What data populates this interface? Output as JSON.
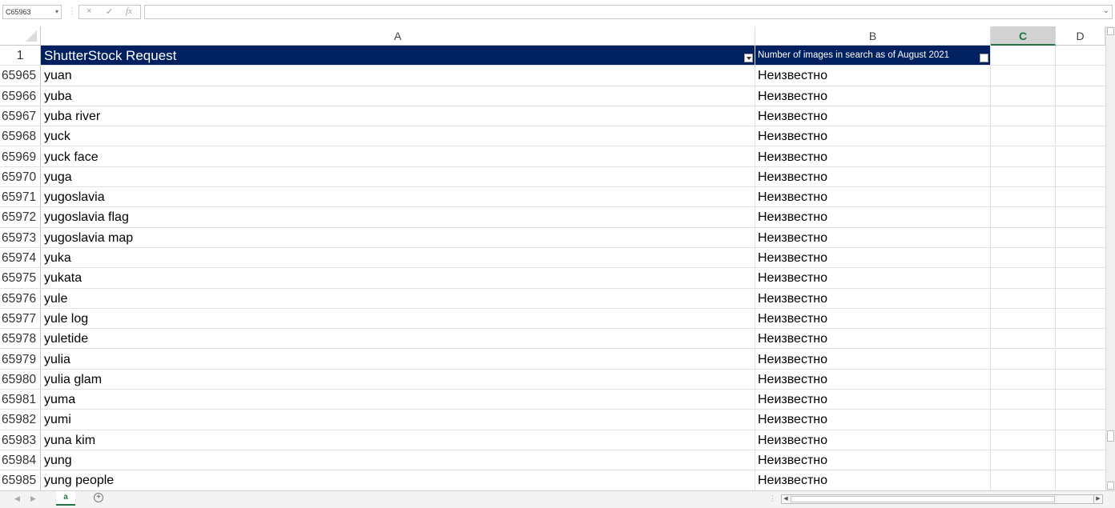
{
  "formula_bar": {
    "name_box": "C65963",
    "cancel_glyph": "×",
    "enter_glyph": "✓",
    "fx_label": "fx",
    "formula_value": ""
  },
  "columns": {
    "A": "A",
    "B": "B",
    "C": "C",
    "D": "D",
    "selected": "C"
  },
  "header_row": {
    "row_number": "1",
    "col_a": "ShutterStock Request",
    "col_b": "Number of images in search as of August 2021"
  },
  "rows": [
    {
      "n": "65965",
      "a": "yuan",
      "b": "Неизвестно"
    },
    {
      "n": "65966",
      "a": "yuba",
      "b": "Неизвестно"
    },
    {
      "n": "65967",
      "a": "yuba river",
      "b": "Неизвестно"
    },
    {
      "n": "65968",
      "a": "yuck",
      "b": "Неизвестно"
    },
    {
      "n": "65969",
      "a": "yuck face",
      "b": "Неизвестно"
    },
    {
      "n": "65970",
      "a": "yuga",
      "b": "Неизвестно"
    },
    {
      "n": "65971",
      "a": "yugoslavia",
      "b": "Неизвестно"
    },
    {
      "n": "65972",
      "a": "yugoslavia flag",
      "b": "Неизвестно"
    },
    {
      "n": "65973",
      "a": "yugoslavia map",
      "b": "Неизвестно"
    },
    {
      "n": "65974",
      "a": "yuka",
      "b": "Неизвестно"
    },
    {
      "n": "65975",
      "a": "yukata",
      "b": "Неизвестно"
    },
    {
      "n": "65976",
      "a": "yule",
      "b": "Неизвестно"
    },
    {
      "n": "65977",
      "a": "yule log",
      "b": "Неизвестно"
    },
    {
      "n": "65978",
      "a": "yuletide",
      "b": "Неизвестно"
    },
    {
      "n": "65979",
      "a": "yulia",
      "b": "Неизвестно"
    },
    {
      "n": "65980",
      "a": "yulia glam",
      "b": "Неизвестно"
    },
    {
      "n": "65981",
      "a": "yuma",
      "b": "Неизвестно"
    },
    {
      "n": "65982",
      "a": "yumi",
      "b": "Неизвестно"
    },
    {
      "n": "65983",
      "a": "yuna kim",
      "b": "Неизвестно"
    },
    {
      "n": "65984",
      "a": "yung",
      "b": "Неизвестно"
    },
    {
      "n": "65985",
      "a": "yung people",
      "b": "Неизвестно"
    }
  ],
  "sheet_tabs": [
    {
      "label": "a",
      "active": true
    }
  ],
  "add_sheet_glyph": "+",
  "icons": {
    "name_box_dropdown": "chevron-down-icon",
    "cancel": "close-icon",
    "enter": "check-icon",
    "function": "fx-icon",
    "filter": "filter-dropdown-icon",
    "sort": "sort-filter-icon",
    "add_sheet": "plus-circle-icon"
  },
  "colors": {
    "header_fill": "#002060",
    "header_text": "#ffffff",
    "selected_column_accent": "#217346"
  }
}
